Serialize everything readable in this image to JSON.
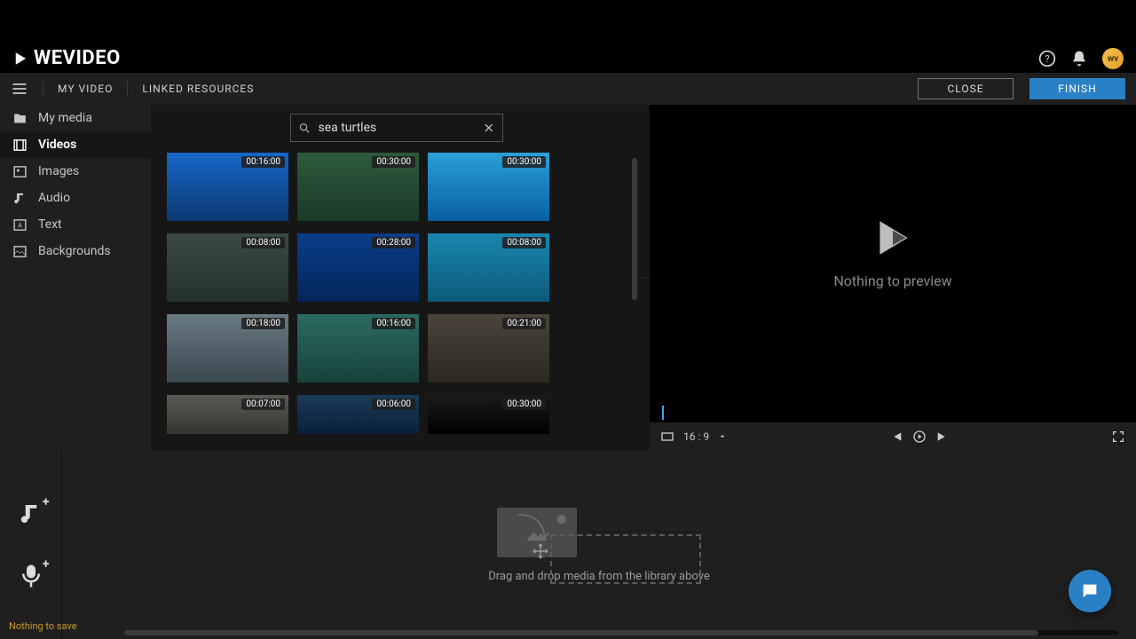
{
  "brand": "WEVIDEO",
  "avatar_initials": "wv",
  "breadcrumbs": {
    "my_video": "MY VIDEO",
    "linked_resources": "LINKED RESOURCES"
  },
  "buttons": {
    "close": "CLOSE",
    "finish": "FINISH"
  },
  "sidebar": {
    "items": [
      {
        "label": "My media"
      },
      {
        "label": "Videos"
      },
      {
        "label": "Images"
      },
      {
        "label": "Audio"
      },
      {
        "label": "Text"
      },
      {
        "label": "Backgrounds"
      }
    ]
  },
  "search": {
    "value": "sea turtles"
  },
  "clips": [
    {
      "duration": "00:16:00"
    },
    {
      "duration": "00:30:00"
    },
    {
      "duration": "00:30:00"
    },
    {
      "duration": "00:08:00"
    },
    {
      "duration": "00:28:00"
    },
    {
      "duration": "00:08:00"
    },
    {
      "duration": "00:18:00"
    },
    {
      "duration": "00:16:00"
    },
    {
      "duration": "00:21:00"
    },
    {
      "duration": "00:07:00"
    },
    {
      "duration": "00:06:00"
    },
    {
      "duration": "00:30:00"
    }
  ],
  "preview": {
    "empty_text": "Nothing to preview",
    "aspect": "16 : 9"
  },
  "timeline": {
    "hint": "Drag and drop media from the library above"
  },
  "status": "Nothing to save"
}
